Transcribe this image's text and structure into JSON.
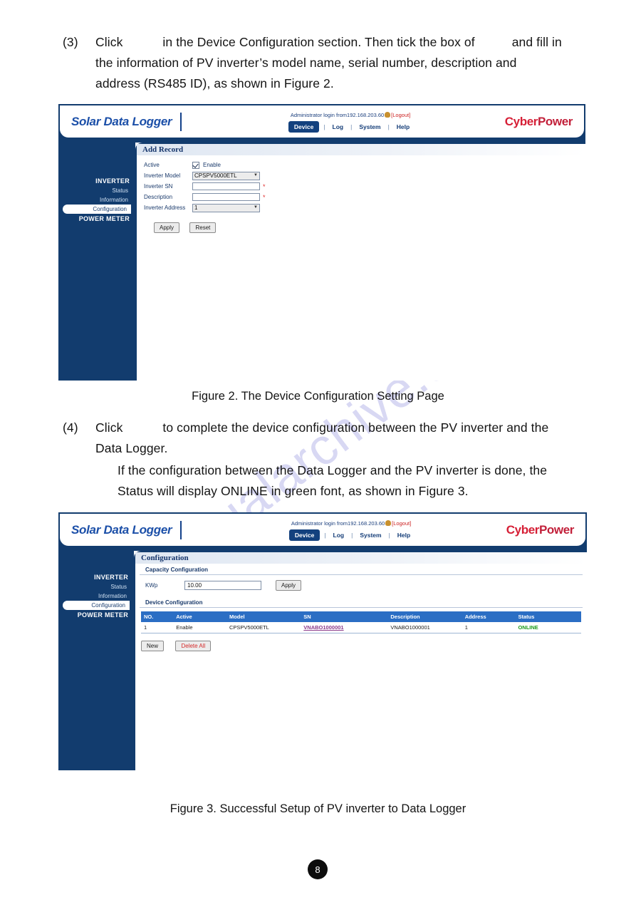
{
  "document": {
    "watermark": "manualarchive.com",
    "page_number": "8",
    "step3": {
      "number": "(3)",
      "line1_a": "Click",
      "line1_b": "in the Device Configuration section. Then tick the box of",
      "line1_c": "and fill in",
      "line2": "the information of PV inverter’s model name, serial number, description and",
      "line3": "address (RS485 ID), as shown in Figure 2."
    },
    "step4": {
      "number": "(4)",
      "line1_a": "Click",
      "line1_b": "to complete the device configuration between the PV inverter and the",
      "line2": "Data Logger.",
      "note_line1": "If the configuration between the Data Logger and the PV inverter is done, the",
      "note_line2": "Status will display ONLINE in green font, as shown in Figure 3."
    },
    "figure2_caption": "Figure 2. The Device Configuration Setting Page",
    "figure3_caption": "Figure 3. Successful Setup of PV inverter to Data Logger"
  },
  "app": {
    "brand": "Solar Data Logger",
    "logo": {
      "part1": "Cyber",
      "part2": "Power"
    },
    "login_prefix": "Administrator login from",
    "login_ip": "192.168.203.60",
    "logout": "[Logout]",
    "nav": [
      {
        "label": "Device",
        "active": true
      },
      {
        "label": "Log",
        "active": false
      },
      {
        "label": "System",
        "active": false
      },
      {
        "label": "Help",
        "active": false
      }
    ],
    "nav_sep": "|",
    "sidebar": {
      "inverter_header": "INVERTER",
      "items": [
        {
          "label": "Status",
          "active": false
        },
        {
          "label": "Information",
          "active": false
        },
        {
          "label": "Configuration",
          "active": true
        }
      ],
      "power_meter_header": "POWER METER"
    }
  },
  "figure2": {
    "panel_title": "Add Record",
    "fields": {
      "active_label": "Active",
      "active_checkbox_label": "Enable",
      "active_checked": true,
      "model_label": "Inverter Model",
      "model_value": "CPSPV5000ETL",
      "sn_label": "Inverter SN",
      "sn_value": "",
      "description_label": "Description",
      "description_value": "",
      "address_label": "Inverter Address",
      "address_value": "1",
      "required_mark": "*"
    },
    "buttons": {
      "apply": "Apply",
      "reset": "Reset"
    }
  },
  "figure3": {
    "panel_title": "Configuration",
    "capacity_section": "Capacity Configuration",
    "capacity_label": "KWp",
    "capacity_value": "10.00",
    "capacity_apply": "Apply",
    "device_section": "Device Configuration",
    "table": {
      "headers": [
        "NO.",
        "Active",
        "Model",
        "SN",
        "Description",
        "Address",
        "Status"
      ],
      "rows": [
        {
          "no": "1",
          "active": "Enable",
          "model": "CPSPV5000ETL",
          "sn": "VNABO1000001",
          "description": "VNABO1000001",
          "address": "1",
          "status": "ONLINE"
        }
      ]
    },
    "buttons": {
      "new": "New",
      "delete_all": "Delete All"
    }
  },
  "colors": {
    "brand_blue": "#1b4fa8",
    "header_navy": "#123c6e",
    "logo_red": "#d61f36",
    "table_header_blue": "#2b6ec4",
    "status_green": "#1a9a1a",
    "link_purple": "#8b3a8b",
    "required_red": "#e03131",
    "watermark": "#ccccf0"
  }
}
